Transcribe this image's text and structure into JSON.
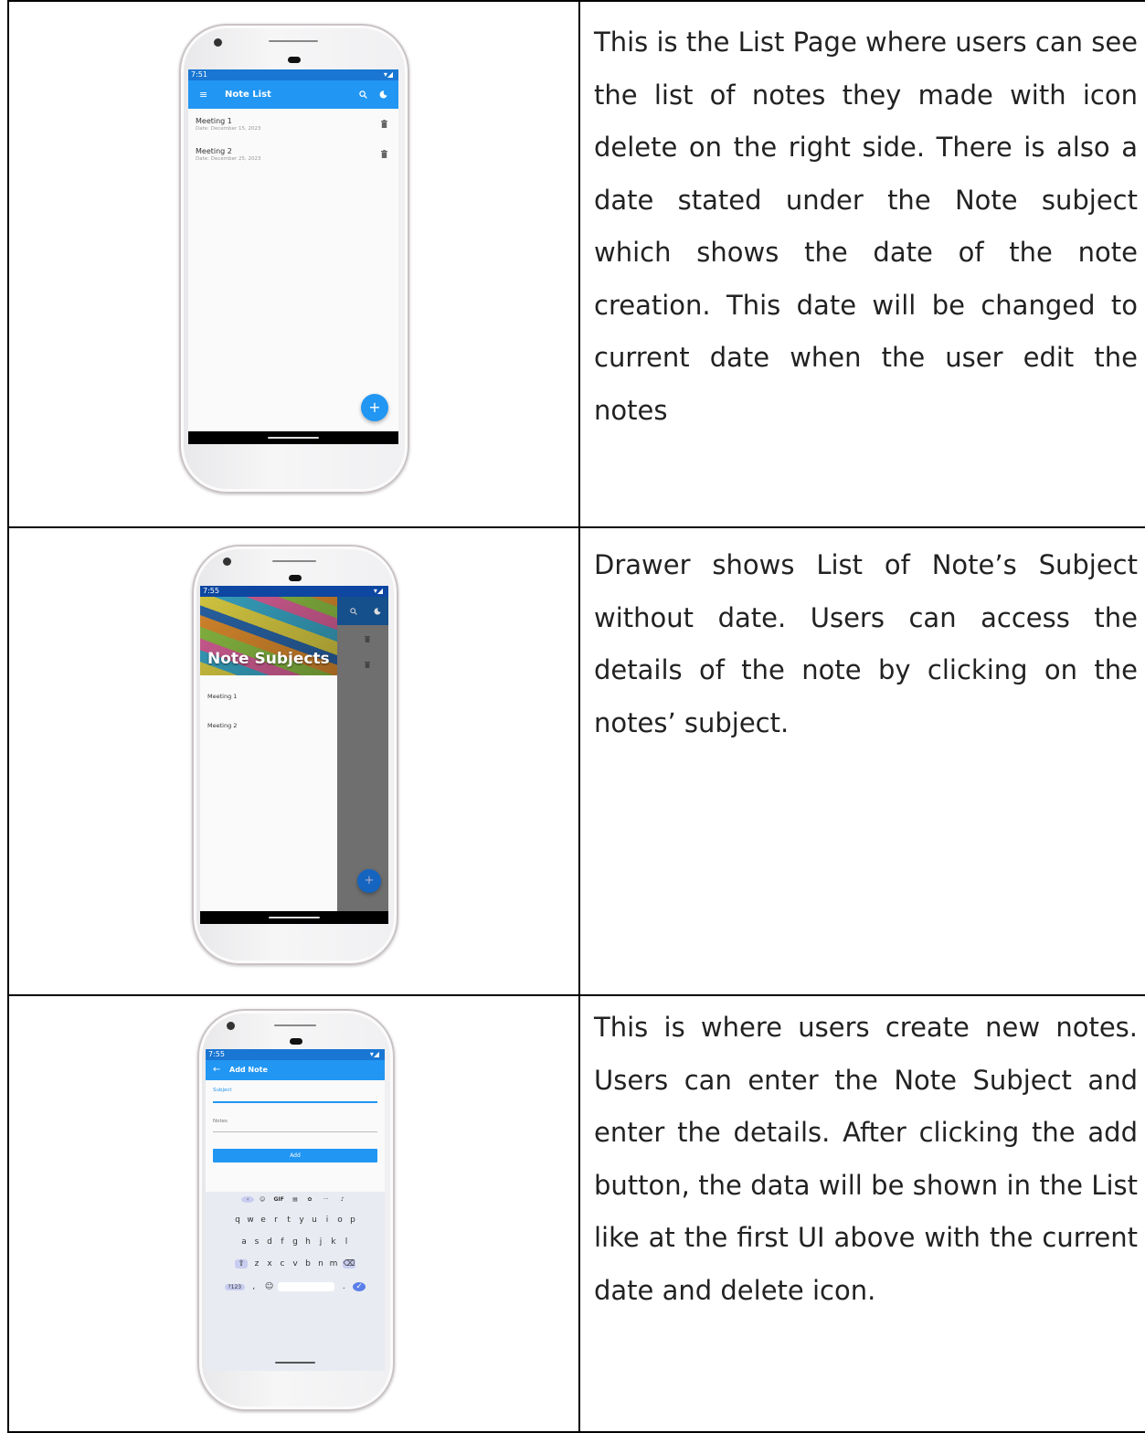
{
  "rows": [
    {
      "description": "This is the List Page where users can see the list of notes they made with icon delete on the right side. There is also a date stated under the Note subject which shows the date of the note creation. This date will be changed to current date when the user edit the notes",
      "phone": {
        "status_time": "7:51",
        "app_title": "Note List",
        "notes": [
          {
            "subject": "Meeting 1",
            "date": "Date: December 15, 2023"
          },
          {
            "subject": "Meeting 2",
            "date": "Date: December 25, 2023"
          }
        ],
        "fab_label": "+"
      }
    },
    {
      "description": "Drawer shows List of Note’s Subject without date. Users can access the details of the note by clicking on the notes’ subject.",
      "phone": {
        "status_time": "7:55",
        "drawer_title": "Note Subjects",
        "drawer_items": [
          "Meeting 1",
          "Meeting 2"
        ],
        "fab_label": "+"
      }
    },
    {
      "description": "This is where users create new notes. Users can enter the Note Subject and enter the details. After clicking the add button, the data will be shown in the List like at the first UI above with the current date and delete icon.",
      "phone": {
        "status_time": "7:55",
        "app_title": "Add Note",
        "subject_label": "Subject",
        "notes_label": "Notes",
        "add_button": "Add",
        "keyboard": {
          "toolbar": [
            "GIF",
            "···"
          ],
          "row1": [
            "q",
            "w",
            "e",
            "r",
            "t",
            "y",
            "u",
            "i",
            "o",
            "p"
          ],
          "row2": [
            "a",
            "s",
            "d",
            "f",
            "g",
            "h",
            "j",
            "k",
            "l"
          ],
          "row3": [
            "z",
            "x",
            "c",
            "v",
            "b",
            "n",
            "m"
          ],
          "symbols_key": "?123",
          "comma_key": ",",
          "period_key": "."
        }
      }
    }
  ],
  "colors": {
    "app_bar": "#2196f3",
    "status_bar": "#1976d2",
    "border": "#000000"
  }
}
